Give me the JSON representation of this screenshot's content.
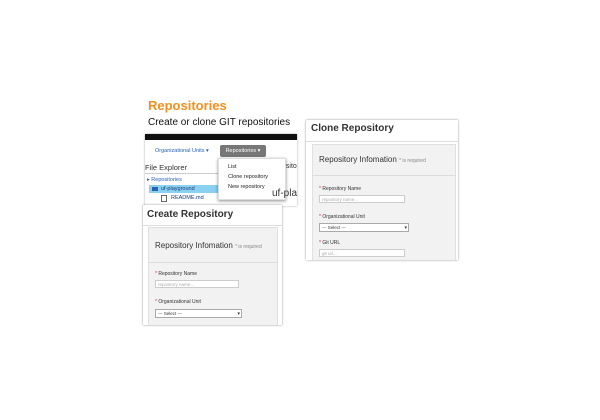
{
  "page": {
    "title": "Repositories",
    "subtitle": "Create or clone GIT repositories",
    "accent_color": "#f0901e"
  },
  "menu_shot": {
    "nav_org": "Organizational Units ▾",
    "nav_repos": "Repositories ▾",
    "file_explorer": "File Explorer",
    "tree": {
      "repositories": "▸ Repositories",
      "uf_playground": "uf-playground",
      "readme": "README.md"
    },
    "dropdown": [
      "List",
      "Clone repository",
      "New repository"
    ],
    "peek_small": "osito",
    "peek_large": "uf-pla"
  },
  "create_shot": {
    "title": "Create Repository",
    "panel_title": "Repository Infomation",
    "required_note": "* is required",
    "name_label": "Repository Name",
    "name_placeholder": "repository name...",
    "org_label": "Organizational Unit",
    "org_value": "--- Select ---"
  },
  "clone_shot": {
    "title": "Clone Repository",
    "panel_title": "Repository Infomation",
    "required_note": "* is required",
    "name_label": "Repository Name",
    "name_placeholder": "repository name...",
    "org_label": "Organizational Unit",
    "org_value": "--- Select ---",
    "git_label": "Git URL",
    "git_placeholder": "git url..."
  }
}
